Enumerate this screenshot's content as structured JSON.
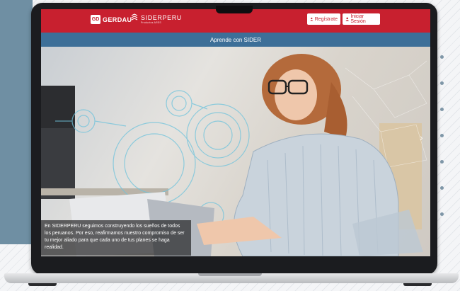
{
  "header": {
    "gerdau_logo_text": "GD",
    "gerdau_name": "GERDAU",
    "sider_name": "SIDERPERU",
    "sider_tagline": "Productos ARES",
    "register_label": "Regístrate",
    "login_label": "Iniciar Sesión"
  },
  "subbar": {
    "title": "Aprende con SIDER"
  },
  "hero": {
    "caption": "En SIDERPERU seguimos construyendo los sueños de todos los peruanos. Por eso, reafirmamos nuestro compromiso de ser tu mejor aliado para que cada uno de tus planes se haga realidad.",
    "next_glyph": "›"
  },
  "colors": {
    "brand_red": "#c8202f",
    "subbar_blue": "#3d6f98",
    "side_panel": "#6f8fa3"
  },
  "icons": [
    "user-icon",
    "gerdau-logo-icon",
    "siderperu-logo-icon",
    "chevron-right-icon"
  ]
}
